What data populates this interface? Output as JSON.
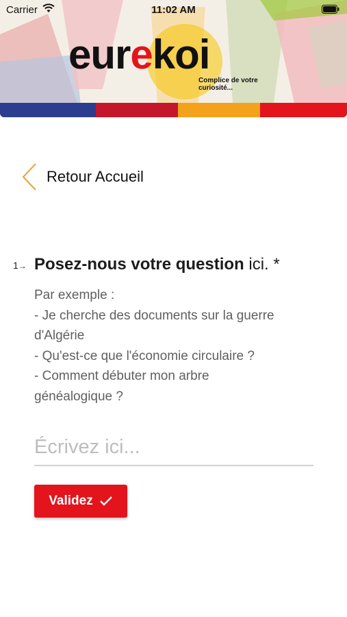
{
  "status_bar": {
    "carrier": "Carrier",
    "time": "11:02 AM"
  },
  "header": {
    "logo": {
      "part1": "eur",
      "part2": "e",
      "part3": "koi"
    },
    "tagline": "Complice de votre curiosité..."
  },
  "nav": {
    "back_label": "Retour Accueil"
  },
  "question": {
    "number": "1",
    "title_bold": "Posez-nous votre question",
    "title_rest": " ici. *",
    "description": [
      "Par exemple :",
      "- Je cherche des documents sur la guerre",
      "d'Algérie",
      "- Qu'est-ce que l'économie circulaire ?",
      "- Comment débuter mon arbre",
      "généalogique ?"
    ],
    "placeholder": "Écrivez ici...",
    "value": ""
  },
  "submit": {
    "label": "Validez"
  },
  "colors": {
    "accent": "#e3141c",
    "back_chevron": "#e8a33c"
  }
}
